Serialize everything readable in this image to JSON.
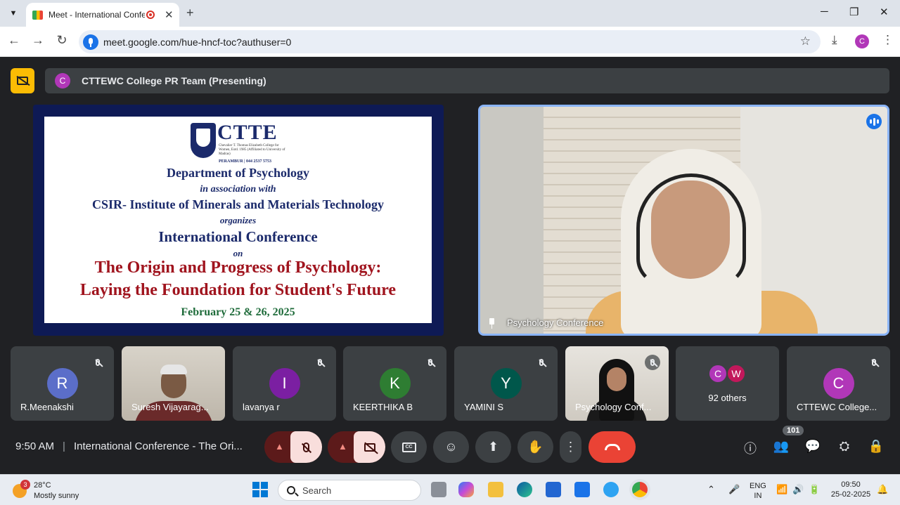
{
  "browser": {
    "tab_title": "Meet - International Confer",
    "tab_close": "✕",
    "new_tab": "+",
    "url": "meet.google.com/hue-hncf-toc?authuser=0",
    "profile_initial": "C",
    "win_min": "─",
    "win_max": "❐",
    "win_close": "✕"
  },
  "meet": {
    "presenter_initial": "C",
    "presenting_text": "CTTEWC College PR Team (Presenting)",
    "slide": {
      "logo_text": "CTTE",
      "logo_sub": "Chevalier T. Thomas Elizabeth College for Women, Estd. 1985 (Affiliated to University of Madras)",
      "logo_city": "PERAMBUR | 044 2537 5753",
      "department": "Department of Psychology",
      "association": "in association with",
      "csir": "CSIR- Institute of Minerals and Materials Technology",
      "organizes": "organizes",
      "conference": "International Conference",
      "on": "on",
      "title_line1": "The Origin and Progress of Psychology:",
      "title_line2": "Laying the Foundation for Student's Future",
      "date": "February 25 & 26, 2025"
    },
    "speaker_label": "Psychology Conference",
    "participants": [
      {
        "initial": "R",
        "name": "R.Meenakshi",
        "color": "#5b6ec9"
      },
      {
        "initial": "",
        "name": "Suresh Vijayarag...",
        "color": ""
      },
      {
        "initial": "I",
        "name": "lavanya r",
        "color": "#7b1fa2"
      },
      {
        "initial": "K",
        "name": "KEERTHIKA B",
        "color": "#2e7d32"
      },
      {
        "initial": "Y",
        "name": "YAMINI S",
        "color": "#00574b"
      },
      {
        "initial": "",
        "name": "Psychology Conf...",
        "color": ""
      },
      {
        "initial": "",
        "name": "92 others",
        "color": ""
      },
      {
        "initial": "C",
        "name": "CTTEWC College...",
        "color": "#b137b8"
      }
    ],
    "others_initials": [
      "C",
      "W"
    ],
    "others_colors": [
      "#b137b8",
      "#c2185b"
    ],
    "time": "9:50 AM",
    "separator": "|",
    "meeting_title": "International Conference - The Ori...",
    "participant_count": "101"
  },
  "taskbar": {
    "temp": "28°C",
    "weather": "Mostly sunny",
    "weather_badge": "3",
    "search_placeholder": "Search",
    "lang1": "ENG",
    "lang2": "IN",
    "time": "09:50",
    "date": "25-02-2025"
  }
}
